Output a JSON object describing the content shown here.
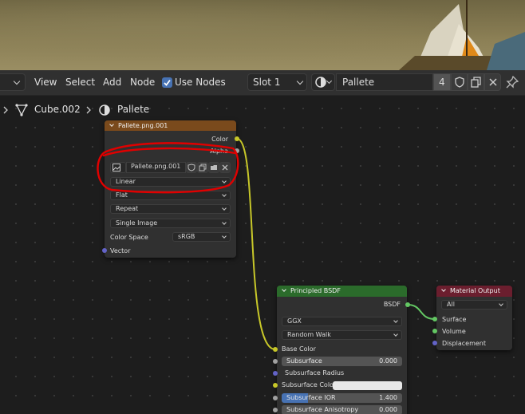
{
  "header": {
    "menu_view": "View",
    "menu_select": "Select",
    "menu_add": "Add",
    "menu_node": "Node",
    "use_nodes_label": "Use Nodes",
    "use_nodes_checked": true,
    "slot_value": "Slot 1",
    "material_name": "Pallete",
    "user_count": "4"
  },
  "breadcrumb": {
    "object": "Cube.002",
    "material": "Pallete"
  },
  "image_node": {
    "title": "Pallete.png.001",
    "out_color": "Color",
    "out_alpha": "Alpha",
    "image_name": "Pallete.png.001",
    "interpolation": "Linear",
    "projection": "Flat",
    "extension": "Repeat",
    "source": "Single Image",
    "color_space_label": "Color Space",
    "color_space_value": "sRGB",
    "in_vector": "Vector",
    "header_color": "#7a4a1c"
  },
  "bsdf_node": {
    "title": "Principled BSDF",
    "out_bsdf": "BSDF",
    "distribution": "GGX",
    "subsurface_method": "Random Walk",
    "base_color": "Base Color",
    "subsurface_label": "Subsurface",
    "subsurface_value": "0.000",
    "subsurface_radius": "Subsurface Radius",
    "subsurface_color": "Subsurface Color",
    "subsurface_ior_label": "Subsurface IOR",
    "subsurface_ior_value": "1.400",
    "subsurface_aniso_label": "Subsurface Anisotropy",
    "subsurface_aniso_value": "0.000",
    "header_color": "#2b6b2b"
  },
  "output_node": {
    "title": "Material Output",
    "target": "All",
    "surface": "Surface",
    "volume": "Volume",
    "displacement": "Displacement",
    "header_color": "#6b1e2e"
  },
  "annotation_color": "#e00000"
}
